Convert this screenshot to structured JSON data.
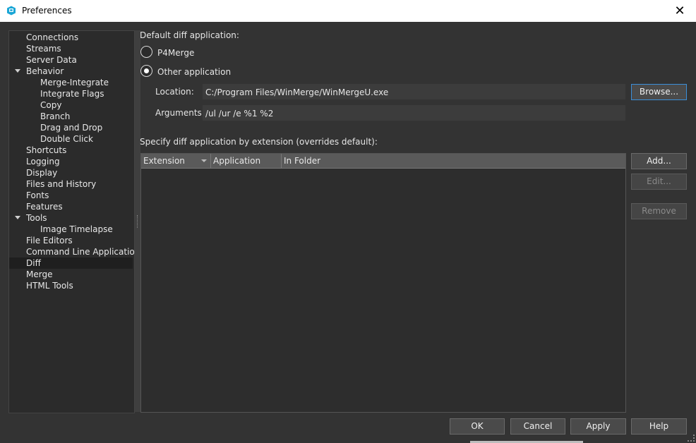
{
  "window": {
    "title": "Preferences"
  },
  "tree": {
    "items": [
      {
        "label": "Connections",
        "level": 1,
        "selected": false
      },
      {
        "label": "Streams",
        "level": 1,
        "selected": false
      },
      {
        "label": "Server Data",
        "level": 1,
        "selected": false
      },
      {
        "label": "Behavior",
        "level": 1,
        "expanded": true,
        "selected": false
      },
      {
        "label": "Merge-Integrate",
        "level": 2,
        "selected": false
      },
      {
        "label": "Integrate Flags",
        "level": 2,
        "selected": false
      },
      {
        "label": "Copy",
        "level": 2,
        "selected": false
      },
      {
        "label": "Branch",
        "level": 2,
        "selected": false
      },
      {
        "label": "Drag and Drop",
        "level": 2,
        "selected": false
      },
      {
        "label": "Double Click",
        "level": 2,
        "selected": false
      },
      {
        "label": "Shortcuts",
        "level": 1,
        "selected": false
      },
      {
        "label": "Logging",
        "level": 1,
        "selected": false
      },
      {
        "label": "Display",
        "level": 1,
        "selected": false
      },
      {
        "label": "Files and History",
        "level": 1,
        "selected": false
      },
      {
        "label": "Fonts",
        "level": 1,
        "selected": false
      },
      {
        "label": "Features",
        "level": 1,
        "selected": false
      },
      {
        "label": "Tools",
        "level": 1,
        "expanded": true,
        "selected": false
      },
      {
        "label": "Image Timelapse",
        "level": 2,
        "selected": false
      },
      {
        "label": "File Editors",
        "level": 1,
        "selected": false
      },
      {
        "label": "Command Line Application",
        "level": 1,
        "selected": false
      },
      {
        "label": "Diff",
        "level": 1,
        "selected": true
      },
      {
        "label": "Merge",
        "level": 1,
        "selected": false
      },
      {
        "label": "HTML Tools",
        "level": 1,
        "selected": false
      }
    ]
  },
  "diff": {
    "default_heading": "Default diff application:",
    "radio_p4merge": "P4Merge",
    "radio_other": "Other application",
    "selected": "other",
    "location_label": "Location:",
    "location_value": "C:/Program Files/WinMerge/WinMergeU.exe",
    "browse_label": "Browse...",
    "arguments_label": "Arguments:",
    "arguments_value": "/ul /ur /e %1 %2",
    "ext_heading": "Specify diff application by extension (overrides default):",
    "columns": [
      "Extension",
      "Application",
      "In Folder"
    ],
    "rows": [],
    "add_label": "Add...",
    "edit_label": "Edit...",
    "remove_label": "Remove"
  },
  "footer": {
    "ok_label": "OK",
    "cancel_label": "Cancel",
    "apply_label": "Apply",
    "help_label": "Help"
  },
  "colors": {
    "accent": "#3b8fd9",
    "app_icon": "#1aa6d6"
  }
}
